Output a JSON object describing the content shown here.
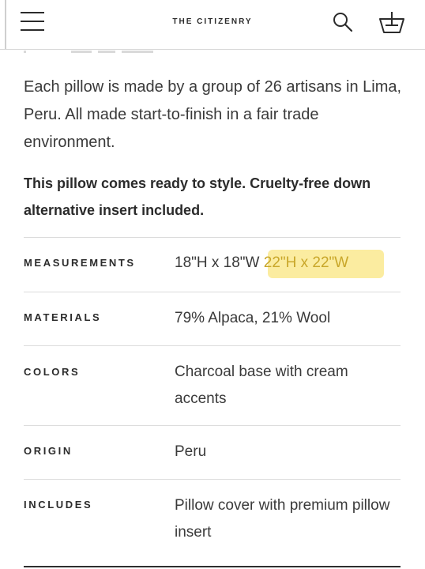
{
  "header": {
    "brand": "THE CITIZENRY",
    "menu_icon": "hamburger-menu-icon",
    "search_icon": "search-icon",
    "cart_icon": "basket-icon"
  },
  "product": {
    "description": "Each pillow is made by a group of 26 artisans in Lima, Peru. All made start-to-finish in a fair trade environment.",
    "note": "This pillow comes ready to style. Cruelty-free down alternative insert included."
  },
  "specs": {
    "measurements": {
      "label": "MEASUREMENTS",
      "value": "18\"H x 18\"W",
      "highlight": "22\"H x 22\"W"
    },
    "materials": {
      "label": "MATERIALS",
      "value": "79% Alpaca, 21% Wool"
    },
    "colors": {
      "label": "COLORS",
      "value": "Charcoal base with cream accents"
    },
    "origin": {
      "label": "ORIGIN",
      "value": "Peru"
    },
    "includes": {
      "label": "INCLUDES",
      "value": "Pillow cover with premium pillow insert"
    }
  },
  "colors": {
    "highlight": "#fbeca0",
    "highlight_text": "#c9a72a",
    "text": "#3a3a3a",
    "divider": "#dcdcdc"
  }
}
